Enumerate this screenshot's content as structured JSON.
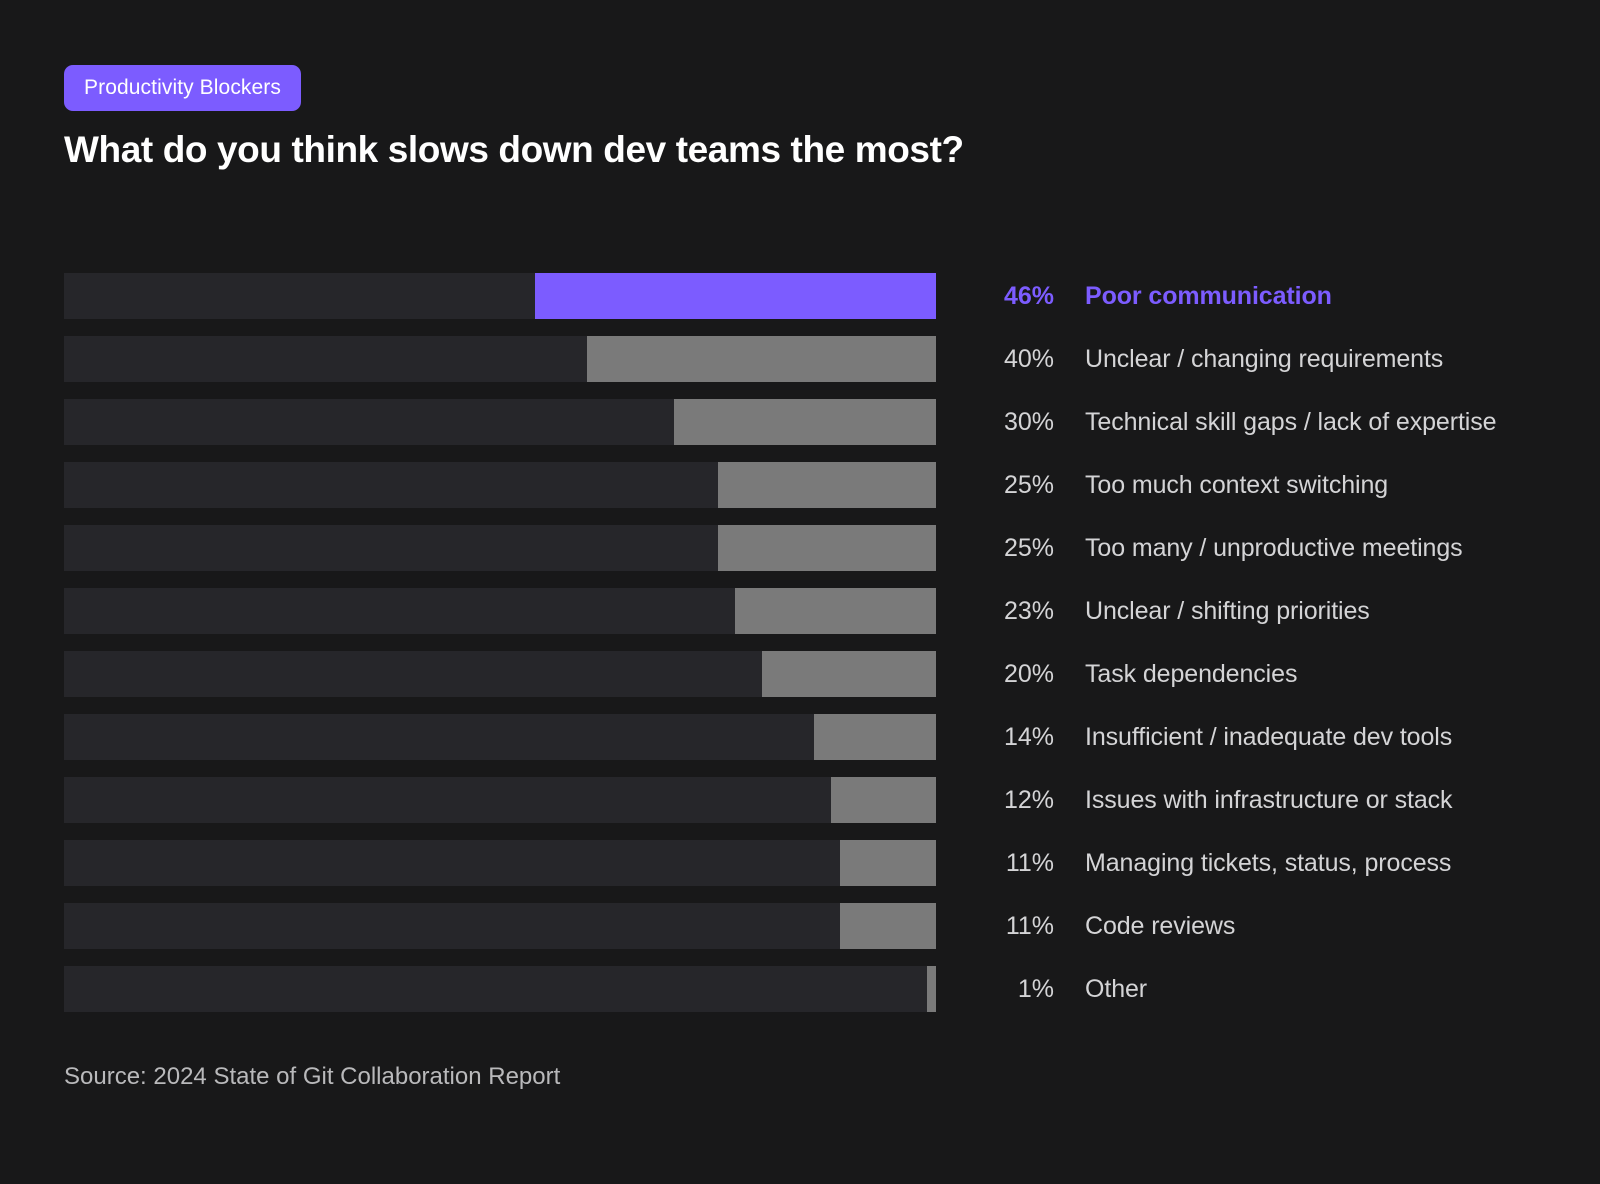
{
  "header": {
    "badge_label": "Productivity Blockers",
    "title": "What do you think slows down dev teams the most?"
  },
  "footer": {
    "source": "Source: 2024 State of Git Collaboration Report"
  },
  "colors": {
    "background": "#181819",
    "track": "#26262a",
    "bar": "#7a7a7a",
    "accent": "#7c5cff",
    "text": "#d4d4d6",
    "title": "#ffffff"
  },
  "chart_data": {
    "type": "bar",
    "orientation": "horizontal",
    "title": "What do you think slows down dev teams the most?",
    "subtitle": "Productivity Blockers",
    "source": "Source: 2024 State of Git Collaboration Report",
    "xlabel": "",
    "ylabel": "",
    "xlim": [
      0,
      100
    ],
    "unit": "%",
    "grid": false,
    "legend": false,
    "bars_right_aligned": true,
    "highlight_index": 0,
    "categories": [
      "Poor communication",
      "Unclear / changing requirements",
      "Technical skill gaps / lack of expertise",
      "Too much context switching",
      "Too many / unproductive meetings",
      "Unclear / shifting priorities",
      "Task dependencies",
      "Insufficient / inadequate dev tools",
      "Issues with infrastructure or stack",
      "Managing tickets, status, process",
      "Code reviews",
      "Other"
    ],
    "values": [
      46,
      40,
      30,
      25,
      25,
      23,
      20,
      14,
      12,
      11,
      11,
      1
    ],
    "value_labels": [
      "46%",
      "40%",
      "30%",
      "25%",
      "25%",
      "23%",
      "20%",
      "14%",
      "12%",
      "11%",
      "11%",
      "1%"
    ],
    "rows": [
      {
        "value": 46,
        "value_label": "46%",
        "label": "Poor communication",
        "highlight": true
      },
      {
        "value": 40,
        "value_label": "40%",
        "label": "Unclear / changing requirements",
        "highlight": false
      },
      {
        "value": 30,
        "value_label": "30%",
        "label": "Technical skill gaps / lack of expertise",
        "highlight": false
      },
      {
        "value": 25,
        "value_label": "25%",
        "label": "Too much context switching",
        "highlight": false
      },
      {
        "value": 25,
        "value_label": "25%",
        "label": "Too many / unproductive meetings",
        "highlight": false
      },
      {
        "value": 23,
        "value_label": "23%",
        "label": "Unclear / shifting priorities",
        "highlight": false
      },
      {
        "value": 20,
        "value_label": "20%",
        "label": "Task dependencies",
        "highlight": false
      },
      {
        "value": 14,
        "value_label": "14%",
        "label": "Insufficient / inadequate dev tools",
        "highlight": false
      },
      {
        "value": 12,
        "value_label": "12%",
        "label": "Issues with infrastructure or stack",
        "highlight": false
      },
      {
        "value": 11,
        "value_label": "11%",
        "label": "Managing tickets, status, process",
        "highlight": false
      },
      {
        "value": 11,
        "value_label": "11%",
        "label": "Code reviews",
        "highlight": false
      },
      {
        "value": 1,
        "value_label": "1%",
        "label": "Other",
        "highlight": false
      }
    ]
  }
}
